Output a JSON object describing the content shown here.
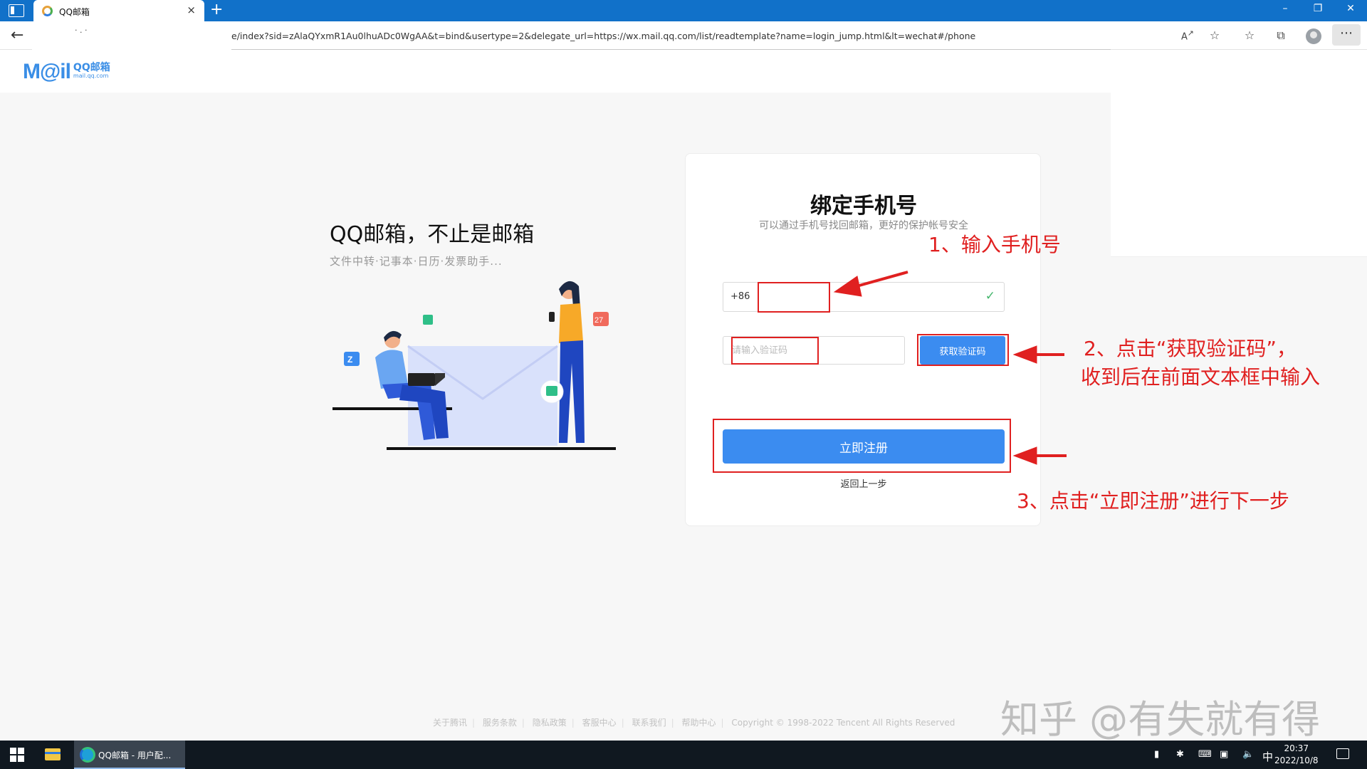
{
  "browser": {
    "tab_title": "QQ邮箱",
    "tab_close": "×",
    "new_tab": "+",
    "site_info": "· . ·",
    "url": "e/index?sid=zAlaQYxmR1Au0lhuADc0WgAA&t=bind&usertype=2&delegate_url=https://wx.mail.qq.com/list/readtemplate?name=login_jump.html&lt=wechat#/phone",
    "icons": [
      "read-aloud-icon",
      "add-favorite-icon",
      "favorites-icon",
      "collections-icon",
      "profile-icon",
      "more-icon"
    ],
    "window_controls": {
      "minimize": "–",
      "restore": "❐",
      "close": "✕"
    }
  },
  "header": {
    "logo_mail": "M@il",
    "logo_qq": "QQ邮箱",
    "logo_domain": "mail.qq.com"
  },
  "hero": {
    "title": "QQ邮箱，不止是邮箱",
    "subtitle": "文件中转·记事本·日历·发票助手...",
    "calendar_badge": "27",
    "folder_badge": "Z"
  },
  "card": {
    "title": "绑定手机号",
    "subtitle": "可以通过手机号找回邮箱，更好的保护帐号安全",
    "country_code": "+86",
    "phone_value": "",
    "check_mark": "✓",
    "code_placeholder": "请输入验证码",
    "get_code_label": "获取验证码",
    "register_label": "立即注册",
    "back_label": "返回上一步"
  },
  "annotations": {
    "step1": "1、输入手机号",
    "step2_line1": "2、点击“获取验证码”，",
    "step2_line2": "收到后在前面文本框中输入",
    "step3": "3、点击“立即注册”进行下一步",
    "color": "#e02020"
  },
  "footer": {
    "links": [
      "关于腾讯",
      "服务条款",
      "隐私政策",
      "客服中心",
      "联系我们",
      "帮助中心"
    ],
    "copyright": "Copyright © 1998-2022 Tencent All Rights Reserved"
  },
  "watermark": "知乎 @有失就有得",
  "taskbar": {
    "edge_task_label": "QQ邮箱 - 用户配...",
    "ime": "中",
    "time": "20:37",
    "date": "2022/10/8"
  },
  "colors": {
    "accent": "#3b8cf0",
    "titlebar": "#1171c9",
    "taskbar": "#101820"
  }
}
